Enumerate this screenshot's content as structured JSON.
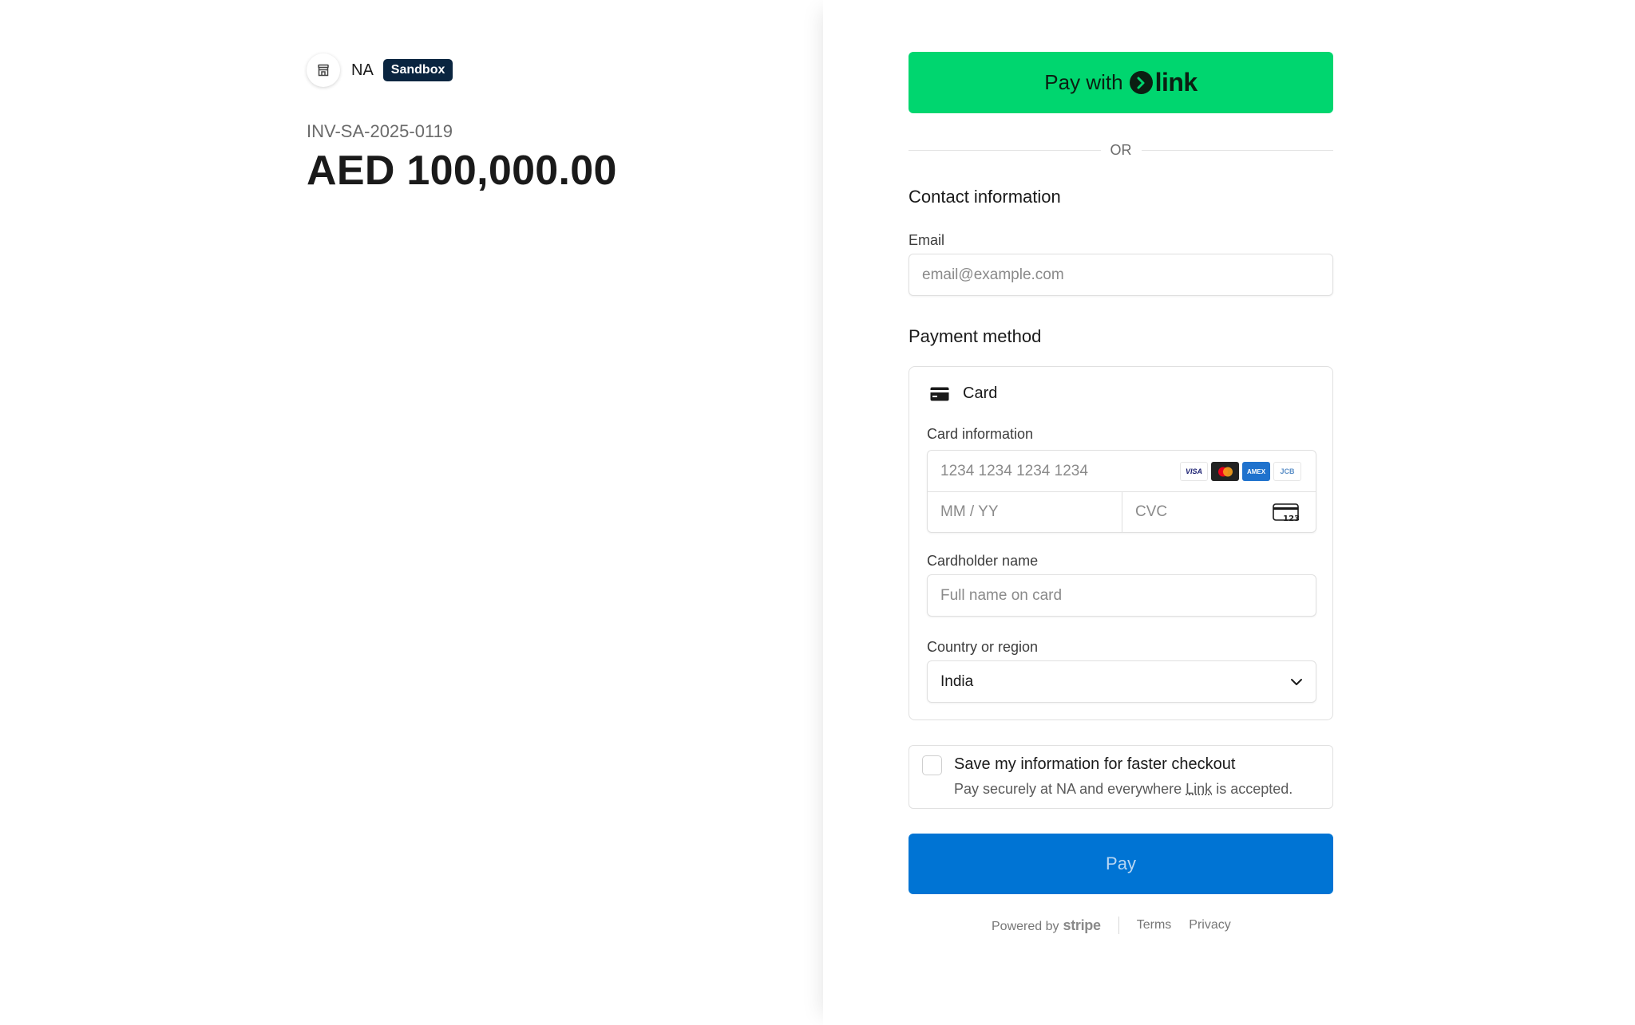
{
  "merchant": {
    "name": "NA",
    "badge": "Sandbox",
    "invoice_id": "INV-SA-2025-0119",
    "amount": "AED 100,000.00"
  },
  "link_button": {
    "prefix": "Pay with",
    "brand": "link"
  },
  "divider": {
    "text": "OR"
  },
  "contact": {
    "title": "Contact information",
    "email_label": "Email",
    "email_placeholder": "email@example.com"
  },
  "payment": {
    "title": "Payment method",
    "method_label": "Card",
    "card_info_label": "Card information",
    "card_number_placeholder": "1234 1234 1234 1234",
    "expiry_placeholder": "MM / YY",
    "cvc_placeholder": "CVC",
    "cvc_icon_text": "123",
    "brands": [
      "VISA",
      "mastercard",
      "AMEX",
      "JCB"
    ],
    "cardholder_label": "Cardholder name",
    "cardholder_placeholder": "Full name on card",
    "country_label": "Country or region",
    "country_value": "India"
  },
  "save_info": {
    "title": "Save my information for faster checkout",
    "sub_before": "Pay securely at NA and everywhere ",
    "sub_link": "Link",
    "sub_after": " is accepted.",
    "checked": false
  },
  "pay_button": {
    "label": "Pay"
  },
  "footer": {
    "powered_by": "Powered by",
    "brand": "stripe",
    "terms": "Terms",
    "privacy": "Privacy"
  },
  "colors": {
    "link_green": "#00d66f",
    "pay_blue": "#0074d4",
    "sandbox_navy": "#0a2540"
  }
}
